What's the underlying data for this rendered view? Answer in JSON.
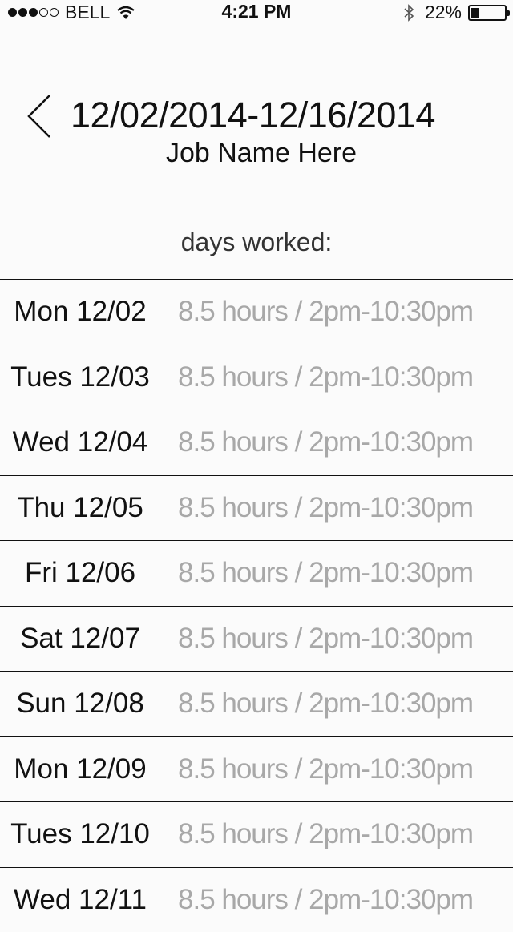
{
  "status_bar": {
    "carrier": "BELL",
    "time": "4:21 PM",
    "battery_percent": "22%",
    "battery_level": 0.22,
    "signal_bars_filled": 3,
    "signal_bars_total": 5
  },
  "header": {
    "back_icon": "chevron-left-icon",
    "title": "12/02/2014-12/16/2014",
    "subtitle": "Job Name Here"
  },
  "section_label": "days worked:",
  "days": [
    {
      "day": "Mon 12/02",
      "detail": "8.5 hours / 2pm-10:30pm"
    },
    {
      "day": "Tues 12/03",
      "detail": "8.5 hours / 2pm-10:30pm"
    },
    {
      "day": "Wed 12/04",
      "detail": "8.5 hours / 2pm-10:30pm"
    },
    {
      "day": "Thu 12/05",
      "detail": "8.5 hours / 2pm-10:30pm"
    },
    {
      "day": "Fri 12/06",
      "detail": "8.5 hours / 2pm-10:30pm"
    },
    {
      "day": "Sat 12/07",
      "detail": "8.5 hours / 2pm-10:30pm"
    },
    {
      "day": "Sun 12/08",
      "detail": "8.5 hours / 2pm-10:30pm"
    },
    {
      "day": "Mon 12/09",
      "detail": "8.5 hours / 2pm-10:30pm"
    },
    {
      "day": "Tues 12/10",
      "detail": "8.5 hours / 2pm-10:30pm"
    },
    {
      "day": "Wed 12/11",
      "detail": "8.5 hours / 2pm-10:30pm"
    }
  ]
}
